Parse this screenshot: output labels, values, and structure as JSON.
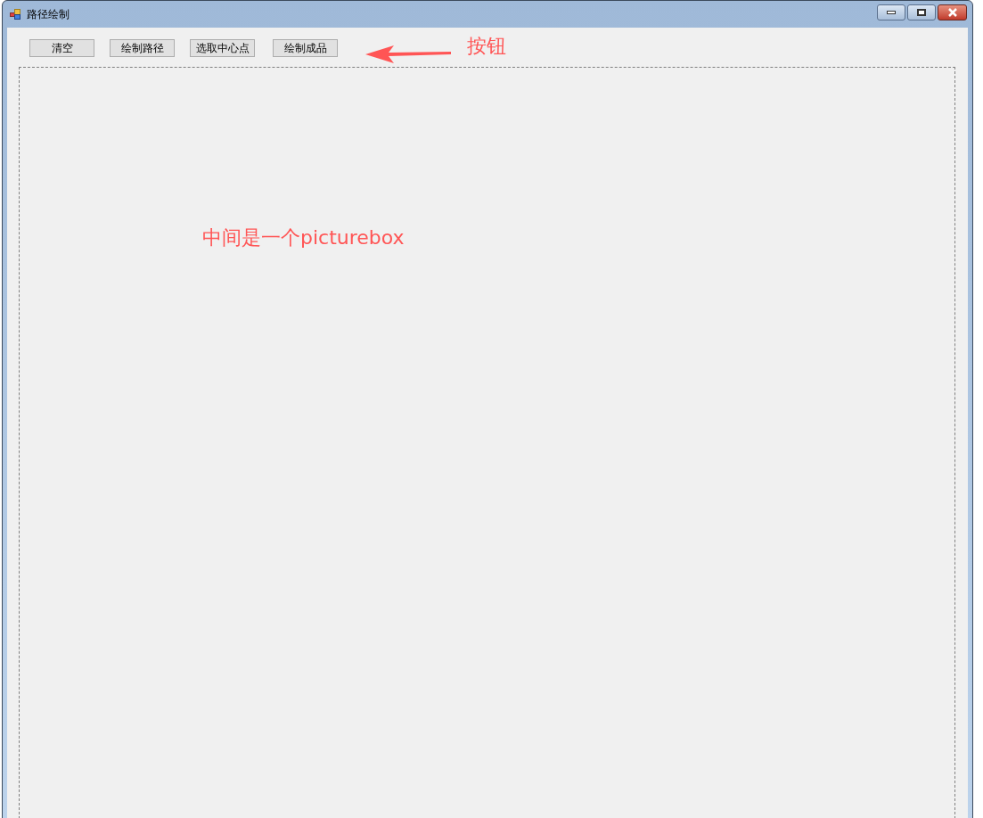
{
  "window": {
    "title": "路径绘制"
  },
  "buttons": [
    "清空",
    "绘制路径",
    "选取中心点",
    "绘制成品"
  ],
  "annotations": [
    {
      "kind": "arrow",
      "text": "按钮"
    },
    {
      "kind": "plain",
      "text": "中间是一个picturebox"
    }
  ]
}
